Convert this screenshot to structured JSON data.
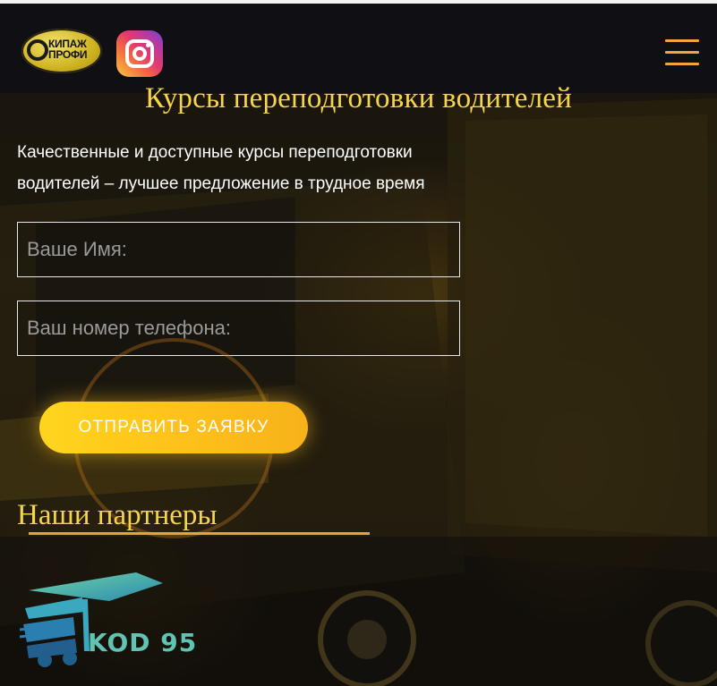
{
  "header": {
    "logo_line1": "КИПАЖ",
    "logo_line2": "ПРОФИ",
    "instagram_icon": "instagram-icon",
    "menu_icon": "hamburger-menu-icon"
  },
  "hero": {
    "title": "Курсы переподготовки водителей",
    "subtitle": "Качественные и доступные курсы переподготовки водителей – лучшее предложение в трудное время"
  },
  "form": {
    "name_placeholder": "Ваше Имя:",
    "phone_placeholder": "Ваш номер телефона:",
    "submit_label": "ОТПРАВИТЬ ЗАЯВКУ"
  },
  "partners": {
    "heading": "Наши партнеры",
    "items": [
      {
        "name": "KOD 95",
        "icon": "truck-icon"
      }
    ]
  },
  "colors": {
    "accent_yellow": "#f7d54a",
    "accent_orange": "#f3a33a",
    "header_bg": "#0f0f14",
    "button_yellow": "#ffd51e",
    "partner_teal": "#5fc4b3"
  }
}
